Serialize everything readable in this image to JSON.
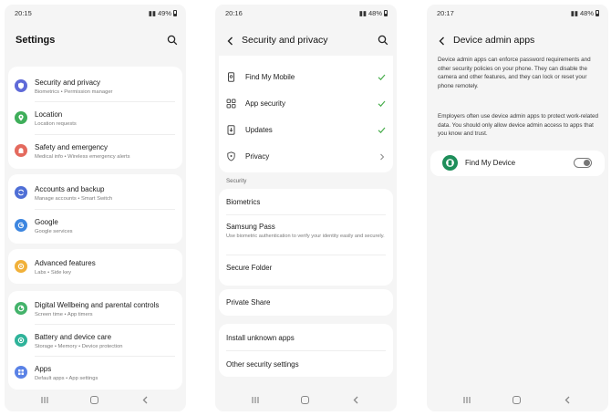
{
  "screen1": {
    "time": "20:15",
    "battery": "49%",
    "title": "Settings",
    "items": [
      {
        "label": "Security and privacy",
        "sub": "Biometrics  •  Permission manager",
        "icon": "shield-icon",
        "color": "#5f6ad8"
      },
      {
        "label": "Location",
        "sub": "Location requests",
        "icon": "location-pin-icon",
        "color": "#3fae5a"
      },
      {
        "label": "Safety and emergency",
        "sub": "Medical info  •  Wireless emergency alerts",
        "icon": "siren-icon",
        "color": "#e46a5e"
      },
      {
        "label": "Accounts and backup",
        "sub": "Manage accounts  •  Smart Switch",
        "icon": "sync-icon",
        "color": "#4f6fd6"
      },
      {
        "label": "Google",
        "sub": "Google services",
        "icon": "google-icon",
        "color": "#3d86e0"
      },
      {
        "label": "Advanced features",
        "sub": "Labs  •  Side key",
        "icon": "star-gear-icon",
        "color": "#f1b13a"
      },
      {
        "label": "Digital Wellbeing and parental controls",
        "sub": "Screen time  •  App timers",
        "icon": "wellbeing-icon",
        "color": "#44b36b"
      },
      {
        "label": "Battery and device care",
        "sub": "Storage  •  Memory  •  Device protection",
        "icon": "device-care-icon",
        "color": "#2fb39a"
      },
      {
        "label": "Apps",
        "sub": "Default apps  •  App settings",
        "icon": "apps-grid-icon",
        "color": "#5a82e6"
      }
    ]
  },
  "screen2": {
    "time": "20:16",
    "battery": "48%",
    "title": "Security and privacy",
    "top_items": [
      {
        "label": "Find My Mobile",
        "icon": "find-mobile-icon"
      },
      {
        "label": "App security",
        "icon": "app-security-icon"
      },
      {
        "label": "Updates",
        "icon": "updates-icon"
      },
      {
        "label": "Privacy",
        "icon": "privacy-icon"
      }
    ],
    "section_label": "Security",
    "biometrics": "Biometrics",
    "samsung_pass": "Samsung Pass",
    "samsung_pass_sub": "Use biometric authentication to verify your identity easily and securely.",
    "secure_folder": "Secure Folder",
    "private_share": "Private Share",
    "install_unknown": "Install unknown apps",
    "other_security": "Other security settings",
    "check_color": "#4caf50"
  },
  "screen3": {
    "time": "20:17",
    "battery": "48%",
    "title": "Device admin apps",
    "desc1": "Device admin apps can enforce password requirements and other security policies on your phone. They can disable the camera and other features, and they can lock or reset your phone remotely.",
    "desc2": "Employers often use device admin apps to protect work-related data. You should only allow device admin access to apps that you know and trust.",
    "app_label": "Find My Device",
    "app_icon_color": "#1e8e5a",
    "toggle_on": false
  }
}
